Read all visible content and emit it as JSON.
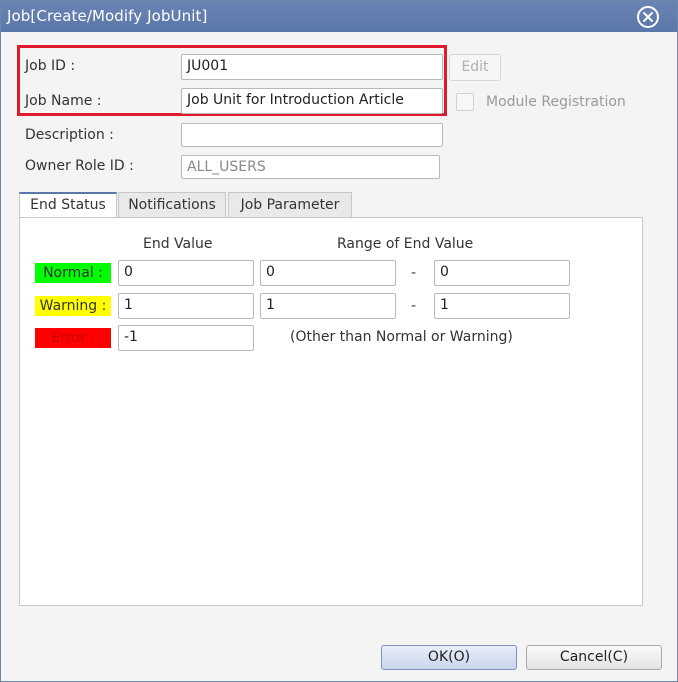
{
  "window": {
    "title": "Job[Create/Modify JobUnit]",
    "close_icon": "close-circle-icon"
  },
  "form": {
    "job_id_label": "Job ID :",
    "job_id_value": "JU001",
    "job_name_label": "Job Name :",
    "job_name_value": "Job Unit for Introduction Article",
    "description_label": "Description :",
    "description_value": "",
    "owner_role_label": "Owner Role ID :",
    "owner_role_value": "ALL_USERS",
    "edit_button": "Edit",
    "module_registration_label": "Module Registration",
    "module_registration_checked": false
  },
  "tabs": [
    {
      "label": "End Status",
      "active": true
    },
    {
      "label": "Notifications",
      "active": false
    },
    {
      "label": "Job Parameter",
      "active": false
    }
  ],
  "end_status": {
    "col_end_value": "End Value",
    "col_range": "Range of End Value",
    "rows": [
      {
        "label": "Normal :",
        "color": "#00ff00",
        "text_color": "#333333",
        "end_value": "0",
        "range_from": "0",
        "dash": "-",
        "range_to": "0"
      },
      {
        "label": "Warning :",
        "color": "#ffff00",
        "text_color": "#333333",
        "end_value": "1",
        "range_from": "1",
        "dash": "-",
        "range_to": "1"
      },
      {
        "label": "Error :",
        "color": "#ff0000",
        "text_color": "#c80000",
        "end_value": "-1",
        "note": "(Other than Normal or Warning)"
      }
    ]
  },
  "footer": {
    "ok_label": "OK(O)",
    "cancel_label": "Cancel(C)"
  }
}
